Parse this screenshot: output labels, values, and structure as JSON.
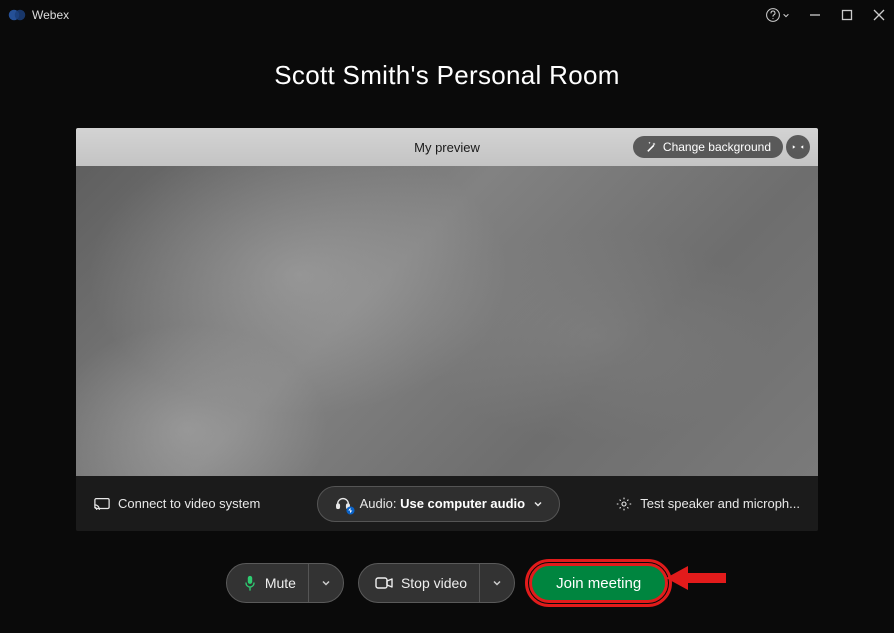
{
  "titleBar": {
    "appName": "Webex"
  },
  "room": {
    "title": "Scott Smith's Personal Room"
  },
  "preview": {
    "headerTitle": "My preview",
    "changeBackground": "Change background"
  },
  "audioRow": {
    "connectVideo": "Connect to video system",
    "audioPrefix": "Audio:",
    "audioValue": "Use computer audio",
    "testSpeaker": "Test speaker and microph..."
  },
  "controls": {
    "mute": "Mute",
    "stopVideo": "Stop video",
    "join": "Join meeting"
  }
}
